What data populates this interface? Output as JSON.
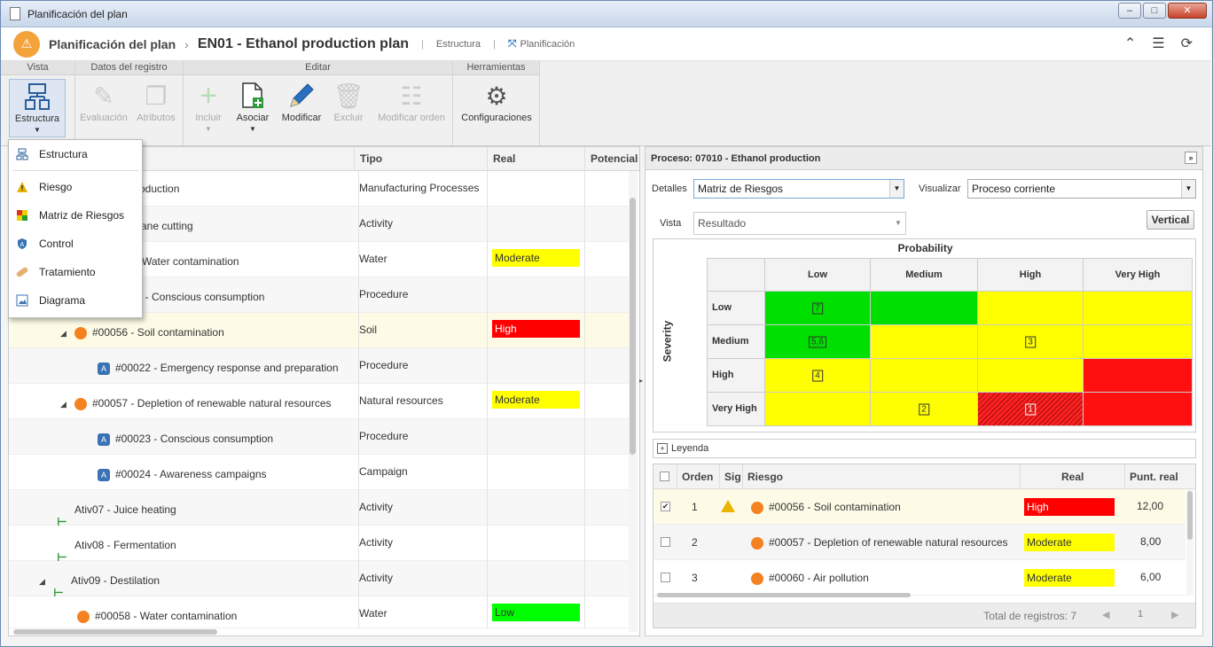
{
  "window": {
    "title": "Planificación del plan"
  },
  "header": {
    "crumb_parent": "Planificación del plan",
    "crumb_separator": "›",
    "crumb_current": "EN01 - Ethanol production plan",
    "link_estructura": "Estructura",
    "link_planificacion": "Planificación"
  },
  "ribbon": {
    "groups": {
      "vista": "Vista",
      "datos": "Datos del registro",
      "editar": "Editar",
      "herramientas": "Herramientas"
    },
    "buttons": {
      "estructura": "Estructura",
      "evaluacion": "Evaluación",
      "atributos": "Atributos",
      "incluir": "Incluir",
      "asociar": "Asociar",
      "modificar": "Modificar",
      "excluir": "Excluir",
      "modificar_orden": "Modificar orden",
      "configuraciones": "Configuraciones"
    }
  },
  "dropdown": {
    "items": [
      "Estructura",
      "Riesgo",
      "Matriz de Riesgos",
      "Control",
      "Tratamiento",
      "Diagrama"
    ]
  },
  "tree": {
    "columns": {
      "tipo": "Tipo",
      "real": "Real",
      "potencial": "Potencial"
    },
    "rows": [
      {
        "label": "roduction",
        "tipo": "Manufacturing Processes",
        "real": ""
      },
      {
        "label": "cane cutting",
        "tipo": "Activity",
        "real": ""
      },
      {
        "label": "Water contamination",
        "tipo": "Water",
        "real": "Moderate"
      },
      {
        "label": "21 - Conscious consumption",
        "tipo": "Procedure",
        "real": ""
      },
      {
        "label": "#00056 - Soil contamination",
        "tipo": "Soil",
        "real": "High"
      },
      {
        "label": "#00022 - Emergency response and preparation",
        "tipo": "Procedure",
        "real": ""
      },
      {
        "label": "#00057 - Depletion of renewable natural resources",
        "tipo": "Natural resources",
        "real": "Moderate"
      },
      {
        "label": "#00023 - Conscious consumption",
        "tipo": "Procedure",
        "real": ""
      },
      {
        "label": "#00024 - Awareness campaigns",
        "tipo": "Campaign",
        "real": ""
      },
      {
        "label": "Ativ07 - Juice heating",
        "tipo": "Activity",
        "real": ""
      },
      {
        "label": "Ativ08 - Fermentation",
        "tipo": "Activity",
        "real": ""
      },
      {
        "label": "Ativ09 - Destilation",
        "tipo": "Activity",
        "real": ""
      },
      {
        "label": "#00058 - Water contamination",
        "tipo": "Water",
        "real": "Low"
      }
    ]
  },
  "right": {
    "title": "Proceso: 07010 - Ethanol production",
    "detalles_label": "Detalles",
    "detalles_value": "Matriz de Riesgos",
    "visualizar_label": "Visualizar",
    "visualizar_value": "Proceso corriente",
    "vista_label": "Vista",
    "vista_value": "Resultado",
    "vertical_button": "Vertical",
    "matrix": {
      "probability_label": "Probability",
      "severity_label": "Severity",
      "columns": [
        "Low",
        "Medium",
        "High",
        "Very High"
      ],
      "rows": [
        "Low",
        "Medium",
        "High",
        "Very High"
      ],
      "markers": {
        "low_low": "7",
        "medium_low": "5,6",
        "medium_high": "3",
        "high_low": "4",
        "veryhigh_medium": "2",
        "veryhigh_high": "1"
      }
    },
    "legend_label": "Leyenda",
    "grid": {
      "columns": {
        "orden": "Orden",
        "sig": "Sig",
        "riesgo": "Riesgo",
        "real": "Real",
        "punt": "Punt. real"
      },
      "rows": [
        {
          "orden": "1",
          "riesgo": "#00056 - Soil contamination",
          "real": "High",
          "punt": "12,00"
        },
        {
          "orden": "2",
          "riesgo": "#00057 - Depletion of renewable natural resources",
          "real": "Moderate",
          "punt": "8,00"
        },
        {
          "orden": "3",
          "riesgo": "#00060 - Air pollution",
          "real": "Moderate",
          "punt": "6,00"
        }
      ],
      "total": "Total de registros: 7",
      "page": "1"
    }
  },
  "colors": {
    "high": "#ff0000",
    "moderate": "#ffff00",
    "low": "#00ff00",
    "accent": "#f3a33a"
  }
}
